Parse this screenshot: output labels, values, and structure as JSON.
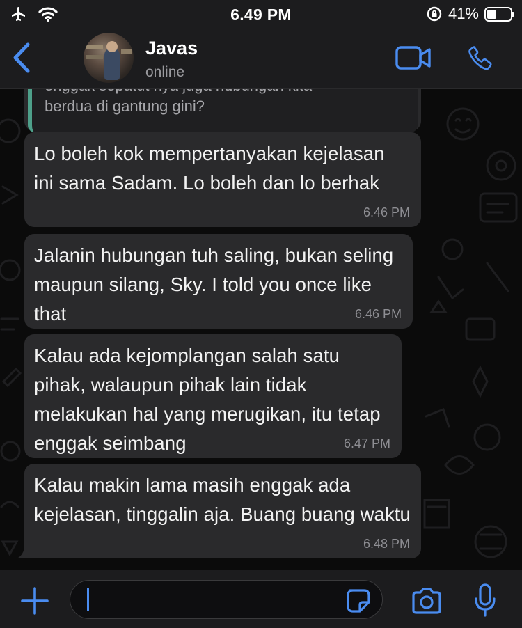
{
  "status_bar": {
    "time": "6.49 PM",
    "battery_percent": "41%",
    "battery_level": 0.41
  },
  "header": {
    "contact_name": "Javas",
    "contact_status": "online"
  },
  "quoted": {
    "line1": "enggak sepatut nya juga hubungan kita",
    "line2": "berdua di gantung gini?"
  },
  "messages": [
    {
      "text": "Lo boleh kok mempertanyakan kejelasan ini sama Sadam. Lo boleh dan lo berhak",
      "time": "6.46 PM"
    },
    {
      "text": "Jalanin hubungan tuh saling, bukan seling maupun silang, Sky. I told you once like that",
      "time": "6.46 PM"
    },
    {
      "text": "Kalau ada kejomplangan salah satu pihak, walaupun pihak lain tidak melakukan hal yang merugikan, itu tetap enggak seimbang",
      "time": "6.47 PM"
    },
    {
      "text": "Kalau makin lama masih enggak ada kejelasan, tinggalin aja. Buang buang waktu",
      "time": "6.48 PM"
    }
  ],
  "input": {
    "value": "",
    "placeholder": ""
  },
  "colors": {
    "accent": "#4a8cf0",
    "bubble": "#2a2a2c",
    "quote_bar": "#4ea08a",
    "bar_bg": "#1c1c1e"
  }
}
